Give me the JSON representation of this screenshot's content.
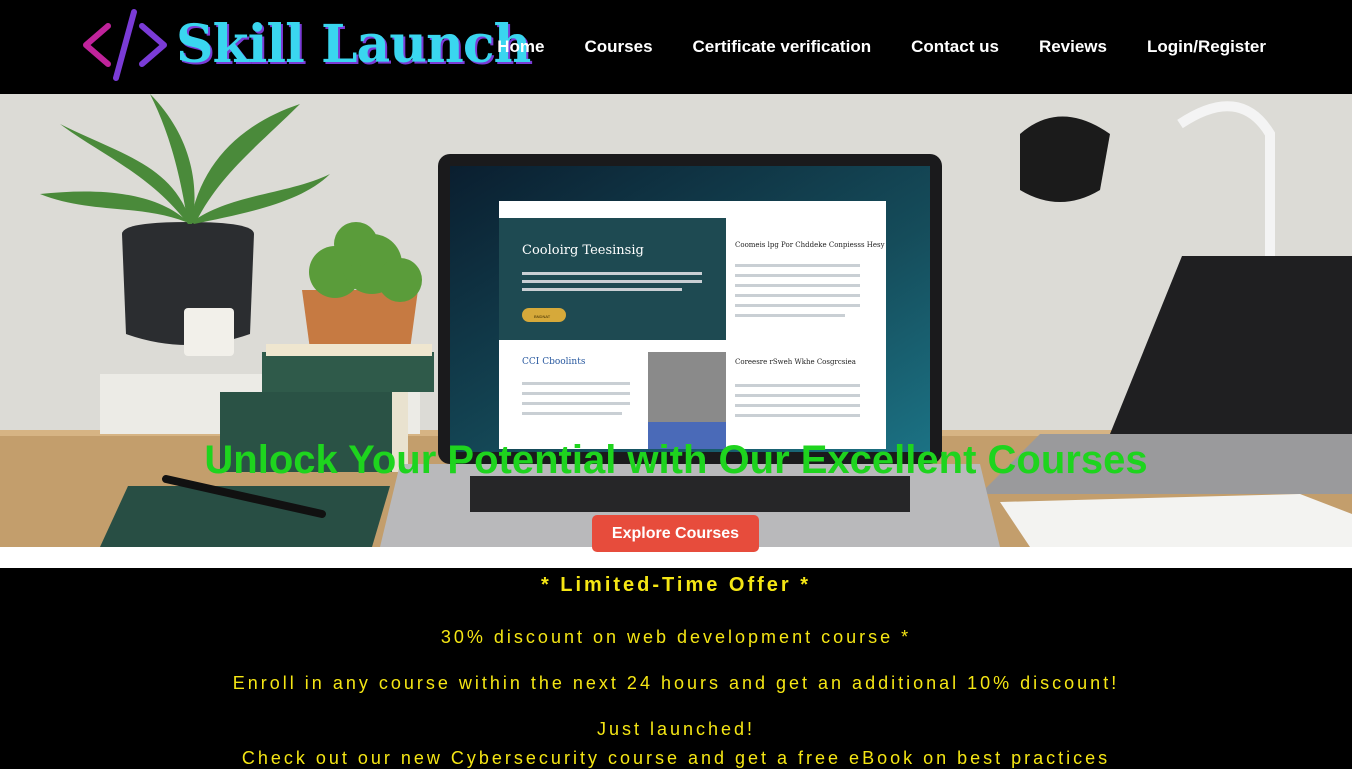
{
  "brand": {
    "name": "Skill Launch",
    "icon": "code-brackets-icon"
  },
  "nav": [
    {
      "label": "Home"
    },
    {
      "label": "Courses"
    },
    {
      "label": "Certificate verification"
    },
    {
      "label": "Contact us"
    },
    {
      "label": "Reviews"
    },
    {
      "label": "Login/Register"
    }
  ],
  "hero": {
    "title": "Unlock Your Potential with Our Excellent Courses",
    "cta": "Explore Courses",
    "image": "desk-laptop-photo",
    "screen": {
      "heading": "Cooloirg Teesinsig",
      "right_heading_1": "Coomeis lpg Por Chddeke Conpiesss Hesy",
      "right_heading_2": "Coreesre rSweh Wkhe Cosgrcsiea",
      "left_heading_2": "CCI Cboolints",
      "button": "BNDNAT"
    }
  },
  "offer": {
    "title": "* Limited-Time Offer *",
    "line1": "30% discount on web development course *",
    "line2": "Enroll in any course within the next 24 hours and get an additional 10% discount!",
    "line3": "Just launched!",
    "line4": "Check out our new Cybersecurity course and get a free eBook on best practices"
  },
  "colors": {
    "accent": "#3ad6ef",
    "hero_title": "#1ed41e",
    "cta": "#e74c3c",
    "offer_text": "#f5e614"
  }
}
